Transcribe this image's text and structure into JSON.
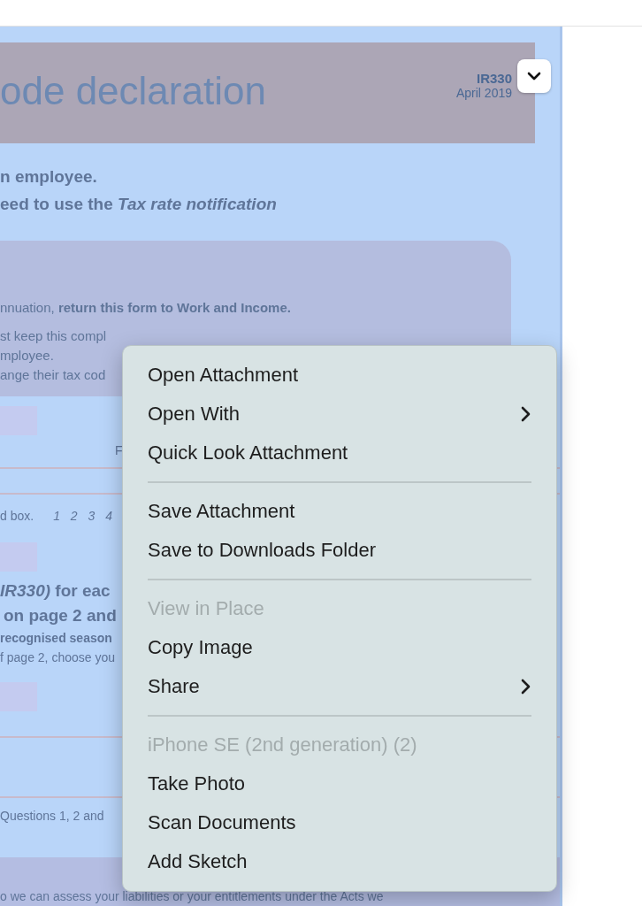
{
  "document": {
    "header": {
      "title": "ode declaration",
      "code": "IR330",
      "date": "April 2019"
    },
    "intro": [
      "n employee.",
      "eed to use the *Tax rate notification*"
    ],
    "notice": [
      "nnuation, **return this form to Work and Income.**",
      "st keep this compl",
      "mployee.",
      "ange their tax cod"
    ],
    "question_1": {
      "label": "F",
      "hint": "d box.",
      "digits": "1 2 3 4"
    },
    "question_2": {
      "lines": [
        "*IR330)* for eac",
        "on page 2 and"
      ],
      "notes": [
        "recognised season",
        "f page 2, choose you"
      ]
    },
    "question_3": {
      "note": "Questions 1, 2 and"
    },
    "footer": "o we can assess your liabilities or your entitlements under the Acts we"
  },
  "context_menu": {
    "groups": [
      [
        {
          "label": "Open Attachment",
          "disabled": false,
          "submenu": false
        },
        {
          "label": "Open With",
          "disabled": false,
          "submenu": true
        },
        {
          "label": "Quick Look Attachment",
          "disabled": false,
          "submenu": false
        }
      ],
      [
        {
          "label": "Save Attachment",
          "disabled": false,
          "submenu": false
        },
        {
          "label": "Save to Downloads Folder",
          "disabled": false,
          "submenu": false
        }
      ],
      [
        {
          "label": "View in Place",
          "disabled": true,
          "submenu": false
        },
        {
          "label": "Copy Image",
          "disabled": false,
          "submenu": false
        },
        {
          "label": "Share",
          "disabled": false,
          "submenu": true
        }
      ],
      [
        {
          "label": "iPhone SE (2nd generation) (2)",
          "disabled": true,
          "submenu": false
        },
        {
          "label": "Take Photo",
          "disabled": false,
          "submenu": false
        },
        {
          "label": "Scan Documents",
          "disabled": false,
          "submenu": false
        },
        {
          "label": "Add Sketch",
          "disabled": false,
          "submenu": false
        }
      ]
    ]
  }
}
